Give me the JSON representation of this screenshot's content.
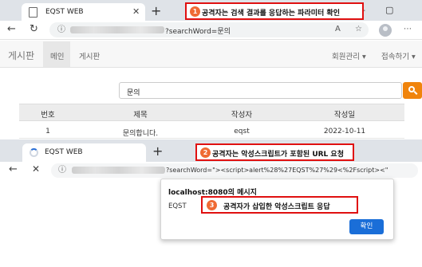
{
  "window1": {
    "tab": {
      "title": "EQST WEB",
      "close": "✕",
      "new_tab": "+"
    },
    "window_controls": {
      "minimize": "—",
      "maximize": "▢"
    },
    "toolbar": {
      "back": "←",
      "refresh": "↻",
      "url_suffix": "?searchWord=문의",
      "read_aloud": "A",
      "favorites": "☆"
    }
  },
  "page": {
    "brand": "게시판",
    "nav": {
      "home": "메인",
      "board": "게시판"
    },
    "nav_right": {
      "members": "회원관리",
      "access": "접속하기"
    },
    "search": {
      "value": "문의"
    },
    "table": {
      "headers": [
        "번호",
        "제목",
        "작성자",
        "작성일"
      ],
      "rows": [
        [
          "1",
          "문의합니다.",
          "eqst",
          "2022-10-11"
        ]
      ]
    }
  },
  "window2": {
    "tab": {
      "title": "EQST WEB",
      "new_tab": "+"
    },
    "toolbar": {
      "back": "←",
      "stop": "✕",
      "url_suffix": "?searchWord=\"><script>alert%28%27EQST%27%29<%2Fscript><\""
    }
  },
  "dialog": {
    "title": "localhost:8080의 메시지",
    "message": "EQST",
    "ok_label": "확인"
  },
  "annotations": [
    {
      "number": "1",
      "text": "공격자는 검색 결과를 응답하는 파라미터 확인"
    },
    {
      "number": "2",
      "text": "공격자는 악성스크립트가 포함된 URL 요청"
    },
    {
      "number": "3",
      "text": "공격자가 삽입한 악성스크립트 응답"
    }
  ],
  "colors": {
    "accent_orange": "#f0840c",
    "callout_red": "#e01010",
    "ok_blue": "#1a6ed8"
  }
}
